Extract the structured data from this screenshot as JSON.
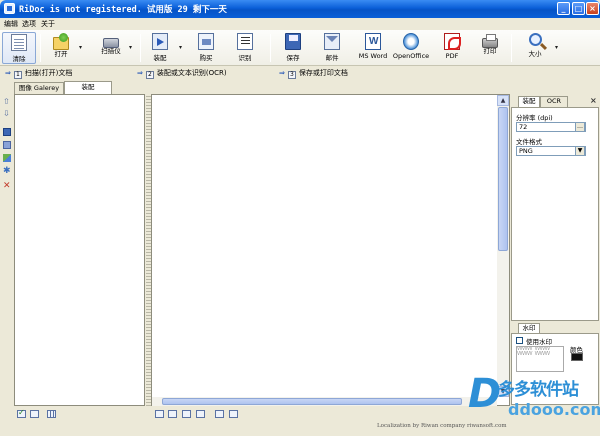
{
  "window": {
    "title": "RiDoc is not registered. 试用版 29 剩下一天",
    "minimize": "_",
    "maximize": "□",
    "close": "×"
  },
  "menu": [
    "编辑",
    "选项",
    "关于"
  ],
  "toolbar": {
    "buttons": [
      {
        "label": "清除",
        "icon": "clear-document-icon"
      },
      {
        "label": "打开",
        "icon": "open-folder-icon"
      },
      {
        "label": "扫描仪",
        "icon": "scanner-icon"
      },
      {
        "label": "装配",
        "icon": "bind-icon"
      },
      {
        "label": "购买",
        "icon": "buy-icon"
      },
      {
        "label": "识别",
        "icon": "ocr-icon"
      },
      {
        "label": "保存",
        "icon": "save-icon"
      },
      {
        "label": "邮件",
        "icon": "mail-icon"
      },
      {
        "label": "MS Word",
        "icon": "word-icon"
      },
      {
        "label": "OpenOffice",
        "icon": "openoffice-icon"
      },
      {
        "label": "PDF",
        "icon": "pdf-icon"
      },
      {
        "label": "打印",
        "icon": "printer-icon"
      },
      {
        "label": "大小",
        "icon": "zoom-icon"
      }
    ]
  },
  "steps": [
    {
      "num": "1",
      "label": "扫描(打开)文档"
    },
    {
      "num": "2",
      "label": "装配或文本识别(OCR)"
    },
    {
      "num": "3",
      "label": "保存或打印文档"
    }
  ],
  "tabs": [
    "图像 Galerey",
    "装配"
  ],
  "right_panel": {
    "tabs": [
      "装配",
      "OCR"
    ],
    "close": "×",
    "resolution_label": "分辨率 (dpi)",
    "resolution_value": "72",
    "resolution_button": "…",
    "format_label": "文件格式",
    "format_value": "PNG",
    "format_arrow": "▼",
    "watermark_tab": "水印",
    "use_watermark_label": "使用水印",
    "watermark_preview": "VVVVVV VVVVVV VVVVVV VVVVVV",
    "color_label": "颜色"
  },
  "scroll": {
    "up": "▲",
    "down": "▼"
  },
  "status": "Localization by Riwan company riwansoft.com",
  "logo": {
    "letter": "D",
    "cn": "多多软件站",
    "url": "ddooo.com"
  },
  "colors": {
    "titlebar": "#0a5fd8",
    "accent": "#2d8fd6"
  }
}
